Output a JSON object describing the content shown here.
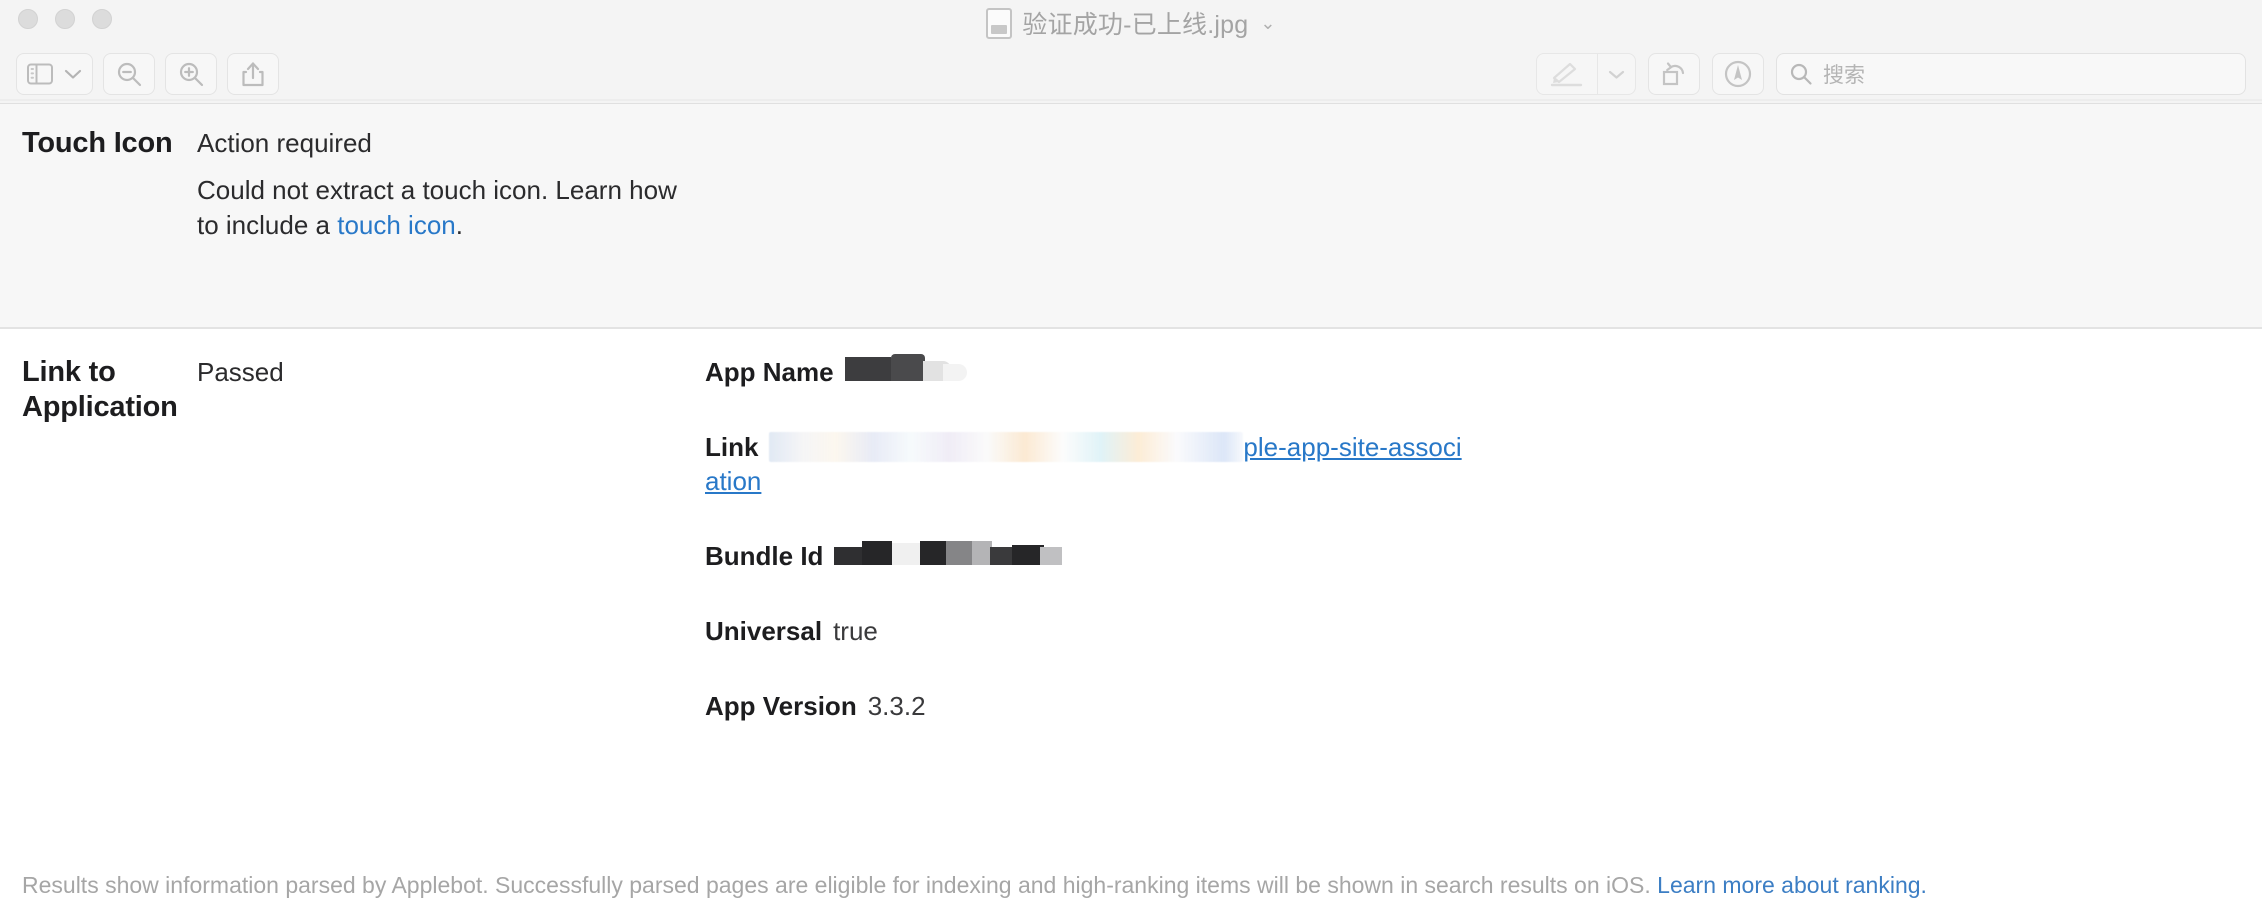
{
  "window": {
    "title": "验证成功-已上线.jpg",
    "title_icon": "document-icon",
    "title_chevron": "⌄",
    "traffic_lights": [
      "close",
      "minimize",
      "zoom"
    ]
  },
  "toolbar": {
    "sidebar_toggle": "sidebar-toggle",
    "sidebar_chevron": "chevron-down-icon",
    "zoom_out": "zoom-out-icon",
    "zoom_in": "zoom-in-icon",
    "share": "share-icon",
    "markup": "markup-pen-icon",
    "markup_chevron": "chevron-down-icon",
    "rotate": "rotate-icon",
    "annotate": "annotate-icon",
    "search": {
      "placeholder": "搜索",
      "value": "",
      "icon": "search-icon"
    }
  },
  "sections": [
    {
      "label": "Touch Icon",
      "status": "Action required",
      "description_pre": "Could not extract a touch icon. Learn how to include a ",
      "description_link": "touch icon",
      "description_post": ".",
      "details": []
    },
    {
      "label": "Link to Application",
      "status": "Passed",
      "details": [
        {
          "key": "App Name",
          "value": "",
          "redacted": "blocks"
        },
        {
          "key": "Link",
          "value_redacted_prefix": "https://www.example.com/.well-known/ap",
          "value_visible_suffix": "ple-app-site-association",
          "redacted": "blur"
        },
        {
          "key": "Bundle Id",
          "value": "",
          "redacted": "blocks"
        },
        {
          "key": "Universal",
          "value": "true",
          "redacted": "none"
        },
        {
          "key": "App Version",
          "value": "3.3.2",
          "redacted": "none"
        }
      ]
    }
  ],
  "footer": {
    "text_pre": "Results show information parsed by Applebot. Successfully parsed pages are eligible for indexing and high-ranking items will be shown in search results on iOS. ",
    "link": "Learn more about ranking."
  },
  "colors": {
    "link": "#2878c8",
    "shaded_row": "#f7f7f7",
    "titlebar": "#f4f4f4",
    "text": "#1d1d1f",
    "footer_text": "#a6a6a6"
  }
}
